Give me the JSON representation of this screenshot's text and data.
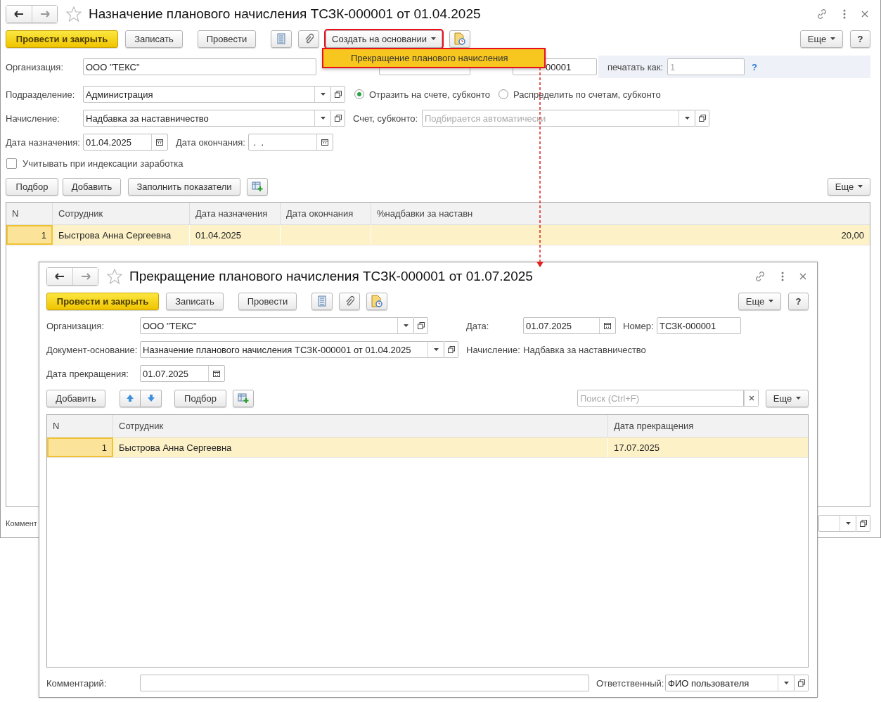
{
  "main_window": {
    "title": "Назначение планового начисления ТСЗК-000001 от 01.04.2025",
    "toolbar": {
      "post_close": "Провести и закрыть",
      "save": "Записать",
      "post": "Провести",
      "create_based": {
        "label": "Создать на основании",
        "highlighted": true
      },
      "more": "Еще",
      "help": "?"
    },
    "organization": {
      "label": "Организация:",
      "value": "ООО \"ТЕКС\""
    },
    "number": {
      "value": "00001"
    },
    "print_as": {
      "label": "печатать как:",
      "placeholder": "1",
      "help": "?"
    },
    "department": {
      "label": "Подразделение:",
      "value": "Администрация"
    },
    "posting_mode": [
      {
        "label": "Отразить на счете, субконто",
        "selected": true
      },
      {
        "label": "Распределить по счетам, субконто",
        "selected": false
      }
    ],
    "accrual": {
      "label": "Начисление:",
      "value": "Надбавка за наставничество"
    },
    "account": {
      "label": "Счет, субконто:",
      "placeholder": "Подбирается автоматически"
    },
    "start_date": {
      "label": "Дата назначения:",
      "value": "01.04.2025"
    },
    "end_date": {
      "label": "Дата окончания:",
      "value": " .  ."
    },
    "indexation": {
      "label": "Учитывать при индексации заработка",
      "checked": false
    },
    "table_toolbar": {
      "pick": "Подбор",
      "add": "Добавить",
      "fill": "Заполнить показатели",
      "more": "Еще"
    },
    "table": {
      "columns": [
        "N",
        "Сотрудник",
        "Дата назначения",
        "Дата окончания",
        "%надбавки за наставн"
      ],
      "rows": [
        {
          "n": "1",
          "employee": "Быстрова Анна Сергеевна",
          "start_date": "01.04.2025",
          "percent": "20,00",
          "selected": true
        }
      ]
    },
    "comment_label": "Коммент"
  },
  "dropdown": {
    "highlighted": true,
    "items": [
      {
        "label": "Прекращение планового начисления",
        "selected": true
      }
    ]
  },
  "child_window": {
    "title": "Прекращение планового начисления ТСЗК-000001 от 01.07.2025",
    "toolbar": {
      "post_close": "Провести и закрыть",
      "save": "Записать",
      "post": "Провести",
      "more": "Еще",
      "help": "?"
    },
    "organization": {
      "label": "Организация:",
      "value": "ООО \"ТЕКС\""
    },
    "date": {
      "label": "Дата:",
      "value": "01.07.2025"
    },
    "number": {
      "label": "Номер:",
      "value": "ТСЗК-000001"
    },
    "basis": {
      "label": "Документ-основание:",
      "value": "Назначение планового начисления ТСЗК-000001 от 01.04.2025"
    },
    "accrual": {
      "label": "Начисление:",
      "value": "Надбавка за наставничество"
    },
    "end_date": {
      "label": "Дата прекращения:",
      "value": "01.07.2025"
    },
    "table_toolbar": {
      "add": "Добавить",
      "pick": "Подбор",
      "search_placeholder": "Поиск (Ctrl+F)",
      "more": "Еще"
    },
    "table": {
      "columns": [
        "N",
        "Сотрудник",
        "Дата прекращения"
      ],
      "rows": [
        {
          "n": "1",
          "employee": "Быстрова Анна Сергеевна",
          "end_date": "17.07.2025",
          "selected": true
        }
      ]
    },
    "comment": {
      "label": "Комментарий:"
    },
    "responsible": {
      "label": "Ответственный:",
      "value": "ФИО пользователя"
    }
  }
}
